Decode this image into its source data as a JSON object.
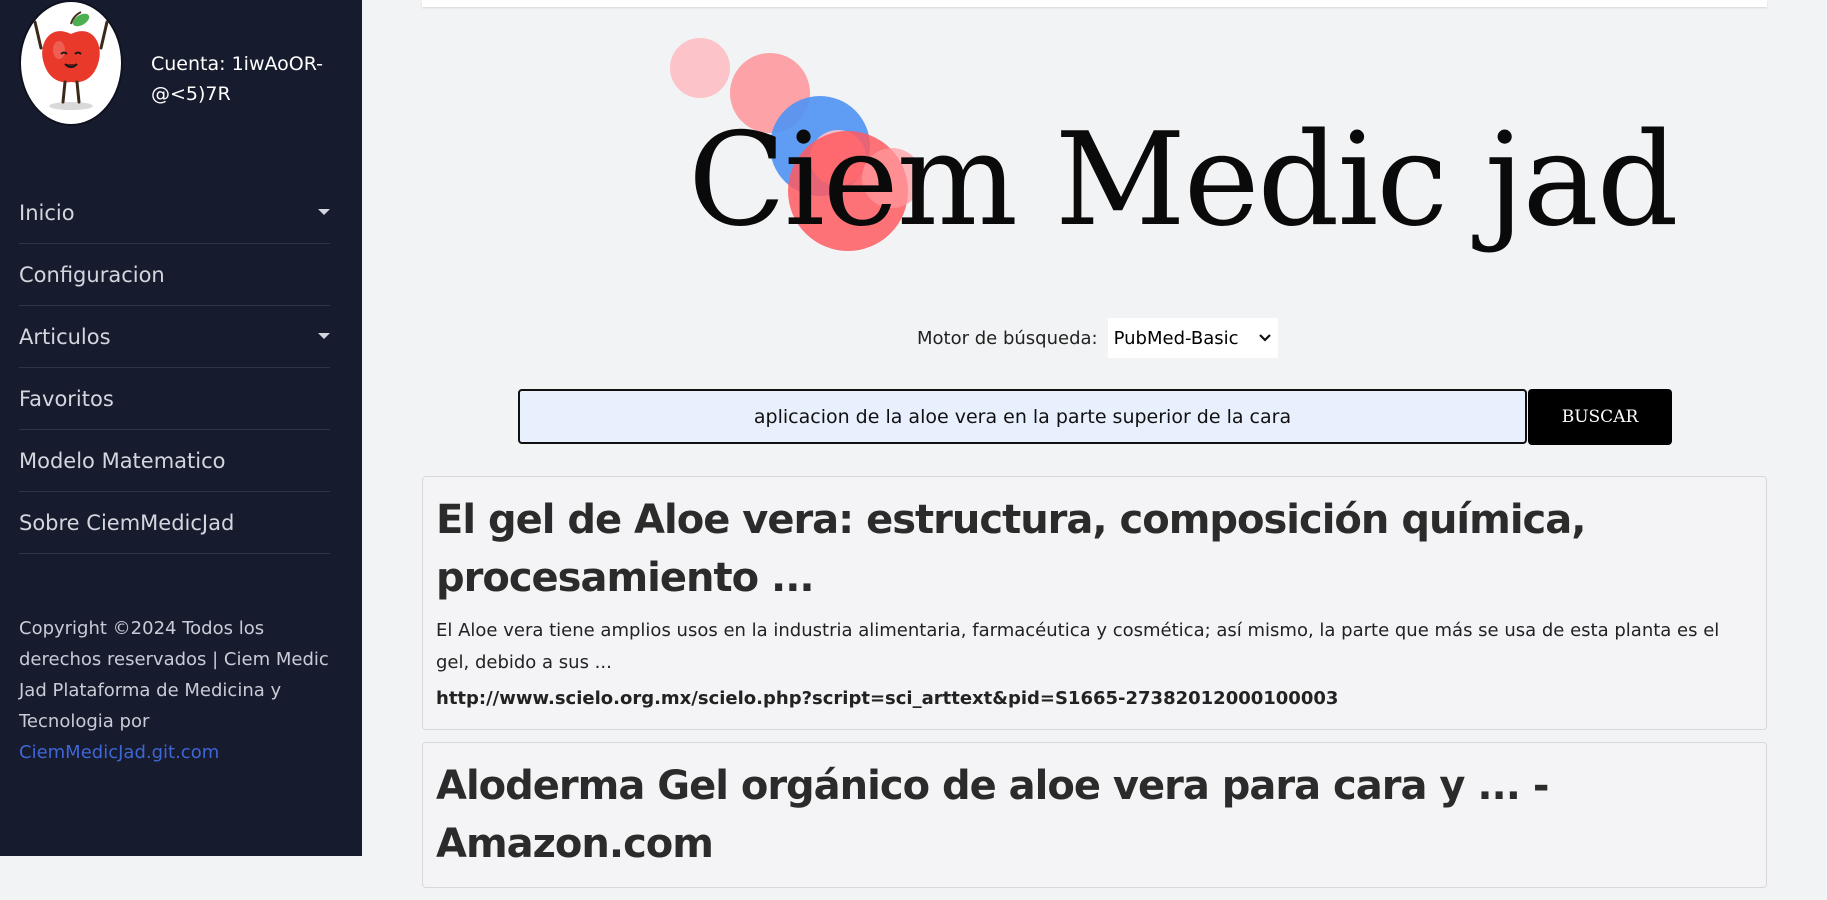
{
  "account": {
    "label": "Cuenta: 1iwAoOR-@<5)7R"
  },
  "sidebar": {
    "items": [
      {
        "label": "Inicio",
        "has_dropdown": true
      },
      {
        "label": "Configuracion",
        "has_dropdown": false
      },
      {
        "label": "Articulos",
        "has_dropdown": true
      },
      {
        "label": "Favoritos",
        "has_dropdown": false
      },
      {
        "label": "Modelo Matematico",
        "has_dropdown": false
      },
      {
        "label": "Sobre CiemMedicJad",
        "has_dropdown": false
      }
    ],
    "copyright_text": "Copyright ©2024 Todos los derechos reservados | Ciem Medic Jad Plataforma de Medicina y Tecnologia por",
    "copyright_link": "CiemMedicJad.git.com"
  },
  "logo": {
    "text": "Ciem Medic jad"
  },
  "search": {
    "engine_label": "Motor de búsqueda:",
    "engine_selected": "PubMed-Basic",
    "query": "aplicacion de la aloe vera en la parte superior de la cara",
    "button_label": "BUSCAR"
  },
  "results": [
    {
      "title": "El gel de Aloe vera: estructura, composición química, procesamiento ...",
      "snippet": "El Aloe vera tiene amplios usos en la industria alimentaria, farmacéutica y cosmética; así mismo, la parte que más se usa de esta planta es el gel, debido a sus ...",
      "url": "http://www.scielo.org.mx/scielo.php?script=sci_arttext&pid=S1665-27382012000100003"
    },
    {
      "title": "Aloderma Gel orgánico de aloe vera para cara y ... - Amazon.com",
      "snippet": "",
      "url": ""
    }
  ],
  "colors": {
    "sidebar_bg": "#171b2e",
    "page_bg": "#f2f3f5",
    "button_bg": "#000000",
    "link": "#3f66d6"
  }
}
